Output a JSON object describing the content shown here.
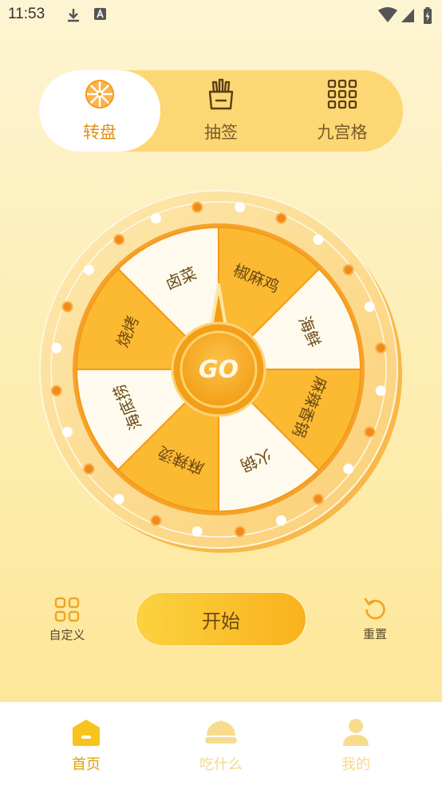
{
  "status_bar": {
    "time": "11:53"
  },
  "mode_tabs": [
    {
      "label": "转盘",
      "icon": "wheel-icon",
      "active": true
    },
    {
      "label": "抽签",
      "icon": "lottery-sticks-icon",
      "active": false
    },
    {
      "label": "九宫格",
      "icon": "grid-nine-icon",
      "active": false
    }
  ],
  "wheel": {
    "segments": [
      "椒麻鸡",
      "海鲜",
      "麻辣香锅",
      "火锅",
      "麻辣烫",
      "海底捞",
      "烧烤",
      "卤菜"
    ],
    "center_label": "GO"
  },
  "actions": {
    "customize_label": "自定义",
    "start_label": "开始",
    "reset_label": "重置"
  },
  "bottom_nav": [
    {
      "label": "首页",
      "icon": "home-icon",
      "active": true
    },
    {
      "label": "吃什么",
      "icon": "food-cover-icon",
      "active": false
    },
    {
      "label": "我的",
      "icon": "profile-icon",
      "active": false
    }
  ],
  "colors": {
    "accent": "#f9b21d",
    "accent_light": "#fdd774",
    "nav_active": "#e0a100",
    "nav_inactive": "#f5d98a",
    "segment_dark": "#fcb932",
    "segment_light": "#fefaed"
  }
}
